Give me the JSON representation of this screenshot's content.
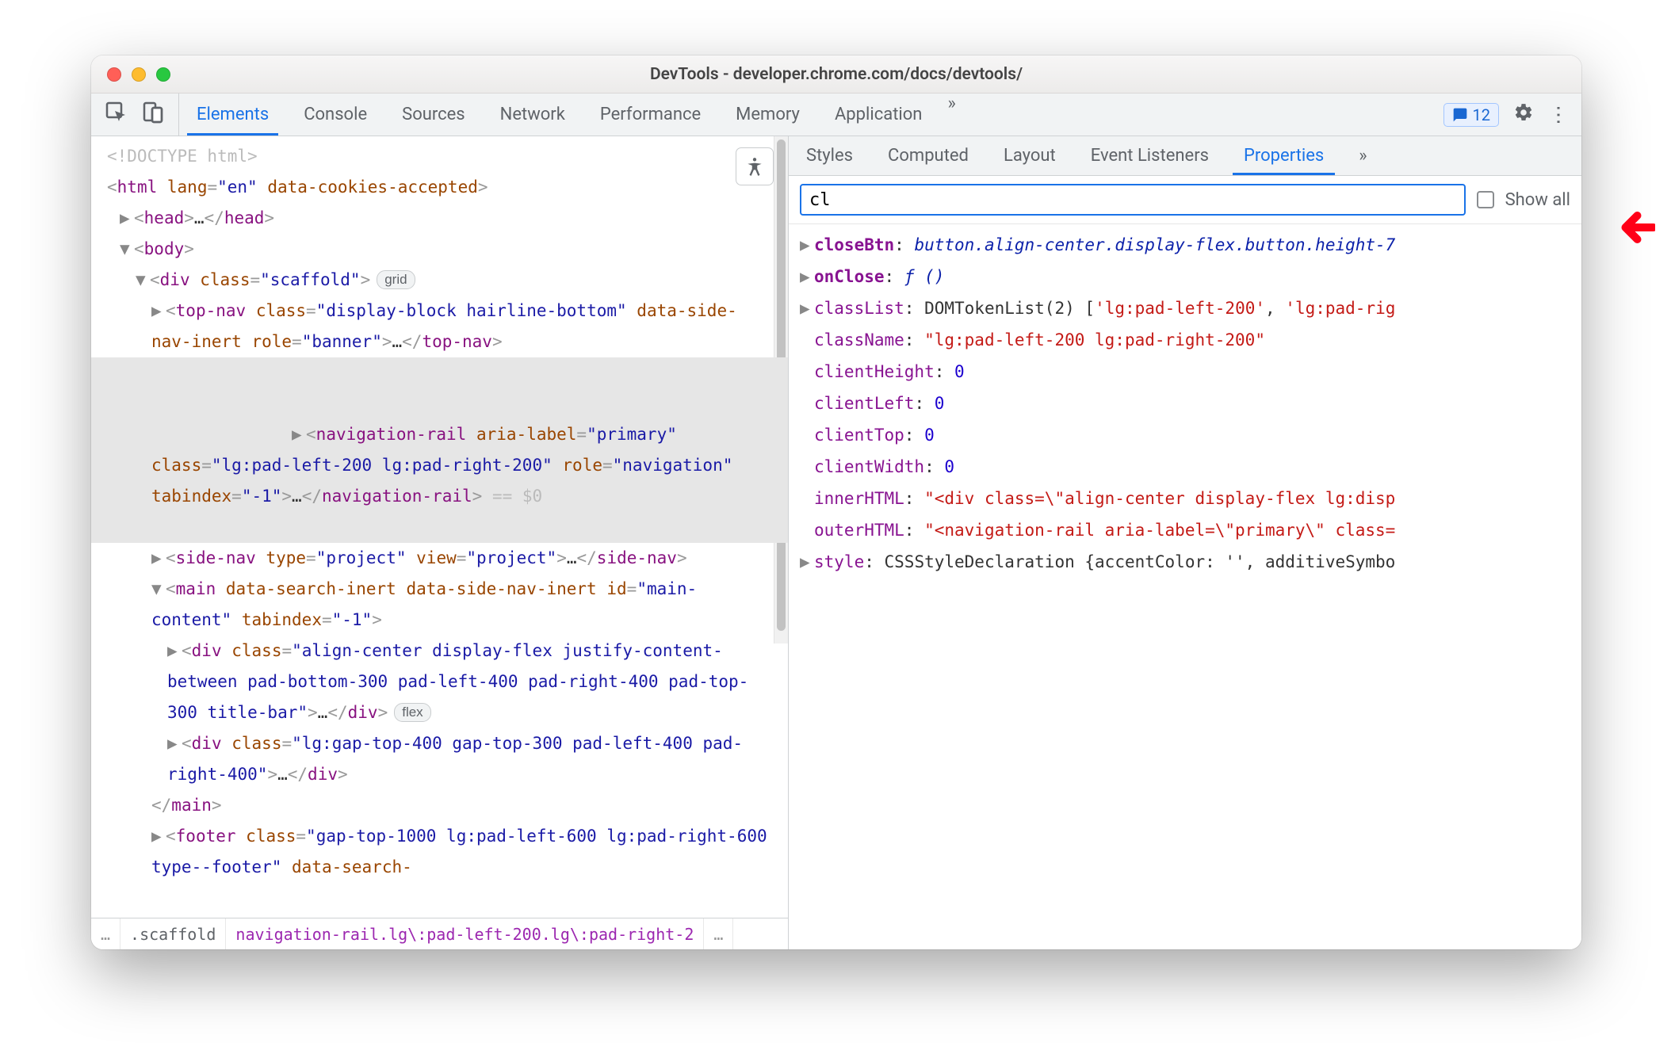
{
  "window": {
    "title": "DevTools - developer.chrome.com/docs/devtools/"
  },
  "main_tabs": {
    "elements": "Elements",
    "console": "Console",
    "sources": "Sources",
    "network": "Network",
    "performance": "Performance",
    "memory": "Memory",
    "application": "Application",
    "overflow": "»"
  },
  "issues": {
    "count": "12"
  },
  "overflow_glyph": "»",
  "dom": {
    "doctype": "<!DOCTYPE html>",
    "html_open_1": "<",
    "html_tag": "html",
    "html_lang_attr": "lang",
    "html_lang_val": "\"en\"",
    "html_cookies_attr": "data-cookies-accepted",
    "html_open_end": ">",
    "head_open": "<",
    "head_tag": "head",
    "head_mid": ">",
    "head_ell": "…",
    "head_close": "</head>",
    "body_open": "<",
    "body_tag": "body",
    "body_close": ">",
    "div_scaffold_open": "<",
    "div_tag": "div",
    "class_attr": "class",
    "scaffold_val": "\"scaffold\"",
    "grid_badge": "grid",
    "topnav_tag": "top-nav",
    "topnav_class_val": "\"display-block hairline-bottom\"",
    "topnav_inert_attr": "data-side-nav-inert",
    "role_attr": "role",
    "banner_val": "\"banner\"",
    "ell": "…",
    "topnav_close": "</top-nav>",
    "navrail_tag": "navigation-rail",
    "aria_label_attr": "aria-label",
    "primary_val": "\"primary\"",
    "navrail_class_val": "\"lg:pad-left-200 lg:pad-right-200\"",
    "navigation_val": "\"navigation\"",
    "tabindex_attr": "tabindex",
    "neg1_val": "\"-1\"",
    "navrail_close": "</navigation-rail>",
    "eq0": "== $0",
    "sidenav_tag": "side-nav",
    "type_attr": "type",
    "project_val": "\"project\"",
    "view_attr": "view",
    "sidenav_close": "</side-nav>",
    "main_tag": "main",
    "search_inert_attr": "data-search-inert",
    "id_attr": "id",
    "maincontent_val": "\"main-content\"",
    "div_align_val": "\"align-center display-flex justify-content-between pad-bottom-300 pad-left-400 pad-right-400 pad-top-300 title-bar\"",
    "div_close": "</div>",
    "flex_badge": "flex",
    "div_gap_val": "\"lg:gap-top-400 gap-top-300 pad-left-400 pad-right-400\"",
    "main_close": "</main>",
    "footer_tag": "footer",
    "footer_class_val": "\"gap-top-1000 lg:pad-left-600 lg:pad-right-600 type--footer\"",
    "footer_search_attr": "data-search-"
  },
  "breadcrumb": {
    "ell": "…",
    "scaffold": ".scaffold",
    "rail": "navigation-rail.lg\\:pad-left-200.lg\\:pad-right-2",
    "trail_ell": "…"
  },
  "side_tabs": {
    "styles": "Styles",
    "computed": "Computed",
    "layout": "Layout",
    "listeners": "Event Listeners",
    "properties": "Properties",
    "overflow": "»"
  },
  "filter": {
    "value": "cl",
    "show_all": "Show all"
  },
  "props": {
    "closeBtn_key": "closeBtn",
    "closeBtn_val": "button.align-center.display-flex.button.height-7",
    "onClose_key": "onClose",
    "onClose_val": "ƒ ()",
    "classList_key": "classList",
    "classList_type": "DOMTokenList(2)",
    "classList_arr_open": "[",
    "classList_v0": "'lg:pad-left-200'",
    "classList_sep": ", ",
    "classList_v1": "'lg:pad-rig",
    "className_key": "className",
    "className_val": "\"lg:pad-left-200 lg:pad-right-200\"",
    "clientHeight_key": "clientHeight",
    "clientHeight_val": "0",
    "clientLeft_key": "clientLeft",
    "clientLeft_val": "0",
    "clientTop_key": "clientTop",
    "clientTop_val": "0",
    "clientWidth_key": "clientWidth",
    "clientWidth_val": "0",
    "innerHTML_key": "innerHTML",
    "innerHTML_val": "\"<div class=\\\"align-center display-flex lg:disp",
    "outerHTML_key": "outerHTML",
    "outerHTML_val": "\"<navigation-rail aria-label=\\\"primary\\\" class=",
    "style_key": "style",
    "style_type": "CSSStyleDeclaration",
    "style_obj": "{accentColor: '', additiveSymbo"
  }
}
